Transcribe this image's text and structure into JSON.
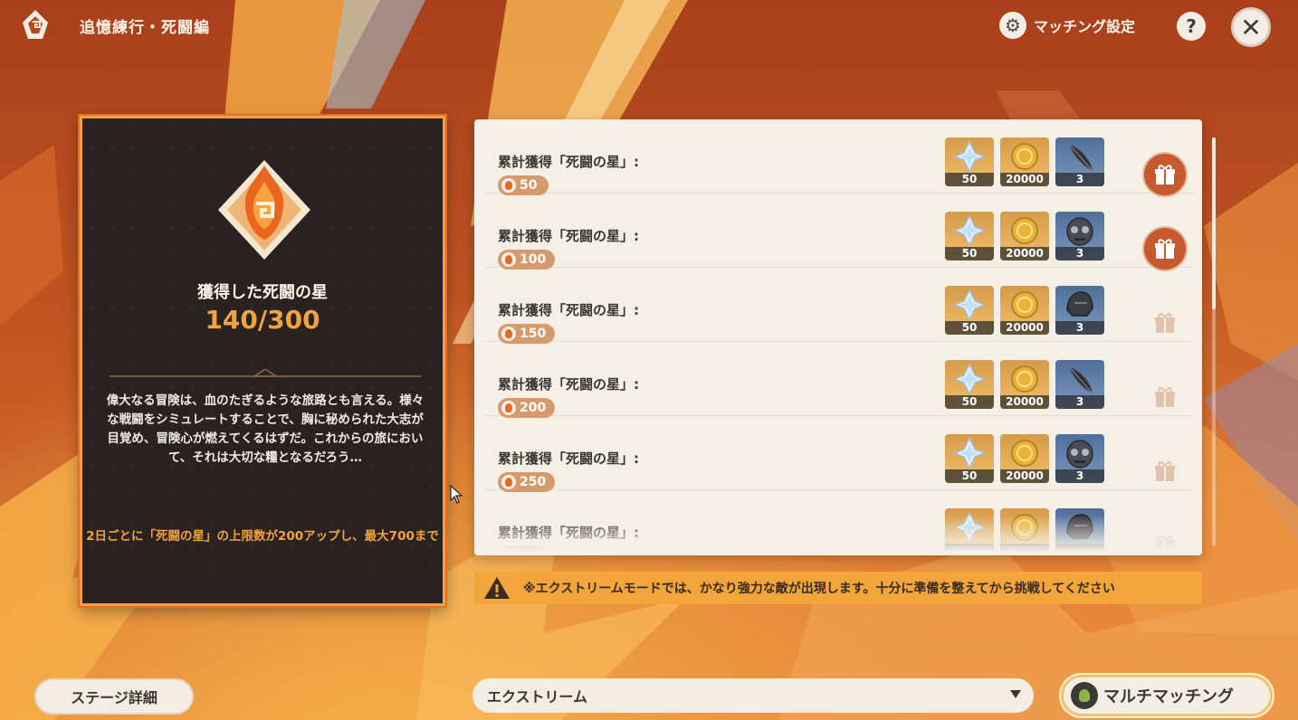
{
  "header": {
    "title": "追憶練行・死闘編",
    "matching_settings": "マッチング設定",
    "help": "?",
    "close": "✕"
  },
  "left_panel": {
    "earned_label": "獲得した死闘の星",
    "earned_value": "140/300",
    "description": "偉大なる冒険は、血のたぎるような旅路とも言える。様々な戦闘をシミュレートすることで、胸に秘められた大志が目覚め、冒険心が燃えてくるはずだ。これからの旅において、それは大切な糧となるだろう…",
    "limit_note": "2日ごとに「死闘の星」の上限数が200アップし、最大700まで"
  },
  "rewards": [
    {
      "label": "累計獲得「死闘の星」:",
      "threshold": "50",
      "items": [
        {
          "icon": "primogem",
          "count": "50"
        },
        {
          "icon": "mora-coin",
          "count": "20000"
        },
        {
          "icon": "feather-material",
          "count": "3"
        }
      ],
      "claimable": true
    },
    {
      "label": "累計獲得「死闘の星」:",
      "threshold": "100",
      "items": [
        {
          "icon": "primogem",
          "count": "50"
        },
        {
          "icon": "mora-coin",
          "count": "20000"
        },
        {
          "icon": "mask-material",
          "count": "3"
        }
      ],
      "claimable": true
    },
    {
      "label": "累計獲得「死闘の星」:",
      "threshold": "150",
      "items": [
        {
          "icon": "primogem",
          "count": "50"
        },
        {
          "icon": "mora-coin",
          "count": "20000"
        },
        {
          "icon": "helmet-material",
          "count": "3"
        }
      ],
      "claimable": false
    },
    {
      "label": "累計獲得「死闘の星」:",
      "threshold": "200",
      "items": [
        {
          "icon": "primogem",
          "count": "50"
        },
        {
          "icon": "mora-coin",
          "count": "20000"
        },
        {
          "icon": "feather-material",
          "count": "3"
        }
      ],
      "claimable": false
    },
    {
      "label": "累計獲得「死闘の星」:",
      "threshold": "250",
      "items": [
        {
          "icon": "primogem",
          "count": "50"
        },
        {
          "icon": "mora-coin",
          "count": "20000"
        },
        {
          "icon": "mask-material",
          "count": "3"
        }
      ],
      "claimable": false
    },
    {
      "label": "累計獲得「死闘の星」:",
      "threshold": "",
      "items": [
        {
          "icon": "primogem",
          "count": ""
        },
        {
          "icon": "mora-coin",
          "count": ""
        },
        {
          "icon": "helmet-material",
          "count": ""
        }
      ],
      "claimable": false
    }
  ],
  "warning": "※エクストリームモードでは、かなり強力な敵が出現します。十分に準備を整えてから挑戦してください",
  "footer": {
    "stage_details": "ステージ詳細",
    "difficulty": "エクストリーム",
    "multi_matching": "マルチマッチング"
  },
  "colors": {
    "accent_orange": "#f1a33d",
    "panel_dark": "#2a2220",
    "gift_active": "#c65a2e"
  }
}
